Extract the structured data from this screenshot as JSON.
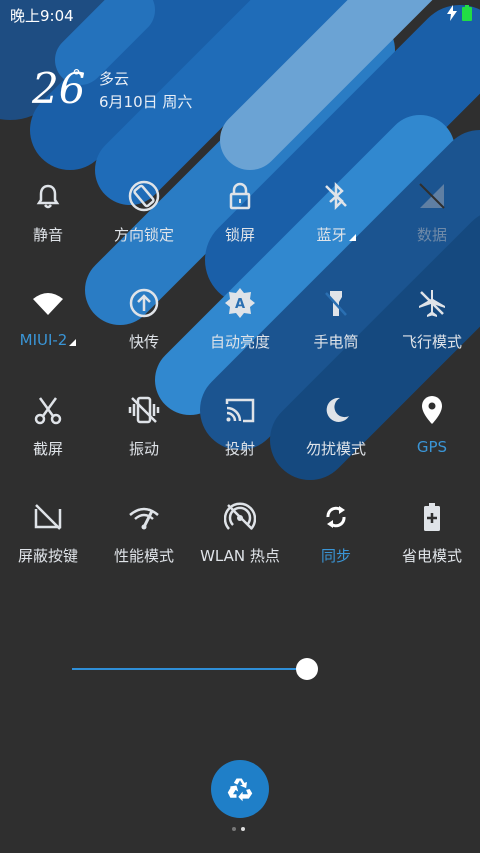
{
  "status": {
    "time": "晚上9:04"
  },
  "weather": {
    "temperature": "26",
    "degree": "°",
    "condition": "多云",
    "date": "6月10日 周六"
  },
  "tiles": [
    {
      "label": "静音",
      "icon": "bell-icon"
    },
    {
      "label": "方向锁定",
      "icon": "rotation-lock-icon"
    },
    {
      "label": "锁屏",
      "icon": "lock-icon"
    },
    {
      "label": "蓝牙",
      "icon": "bluetooth-off-icon"
    },
    {
      "label": "数据",
      "icon": "mobile-data-off-icon"
    },
    {
      "label": "MIUI-2",
      "icon": "wifi-icon"
    },
    {
      "label": "快传",
      "icon": "quick-transfer-icon"
    },
    {
      "label": "自动亮度",
      "icon": "auto-brightness-icon"
    },
    {
      "label": "手电筒",
      "icon": "flashlight-icon"
    },
    {
      "label": "飞行模式",
      "icon": "airplane-icon"
    },
    {
      "label": "截屏",
      "icon": "scissors-icon"
    },
    {
      "label": "振动",
      "icon": "vibrate-icon"
    },
    {
      "label": "投射",
      "icon": "cast-icon"
    },
    {
      "label": "勿扰模式",
      "icon": "moon-icon"
    },
    {
      "label": "GPS",
      "icon": "location-pin-icon"
    },
    {
      "label": "屏蔽按键",
      "icon": "block-keys-icon"
    },
    {
      "label": "性能模式",
      "icon": "performance-icon"
    },
    {
      "label": "WLAN 热点",
      "icon": "hotspot-off-icon"
    },
    {
      "label": "同步",
      "icon": "sync-icon"
    },
    {
      "label": "省电模式",
      "icon": "battery-saver-icon"
    }
  ],
  "brightness": {
    "level": 0.95
  },
  "fab_icon": "recycle-icon",
  "colors": {
    "accent": "#3a95d6",
    "background": "#2f2f2f"
  }
}
